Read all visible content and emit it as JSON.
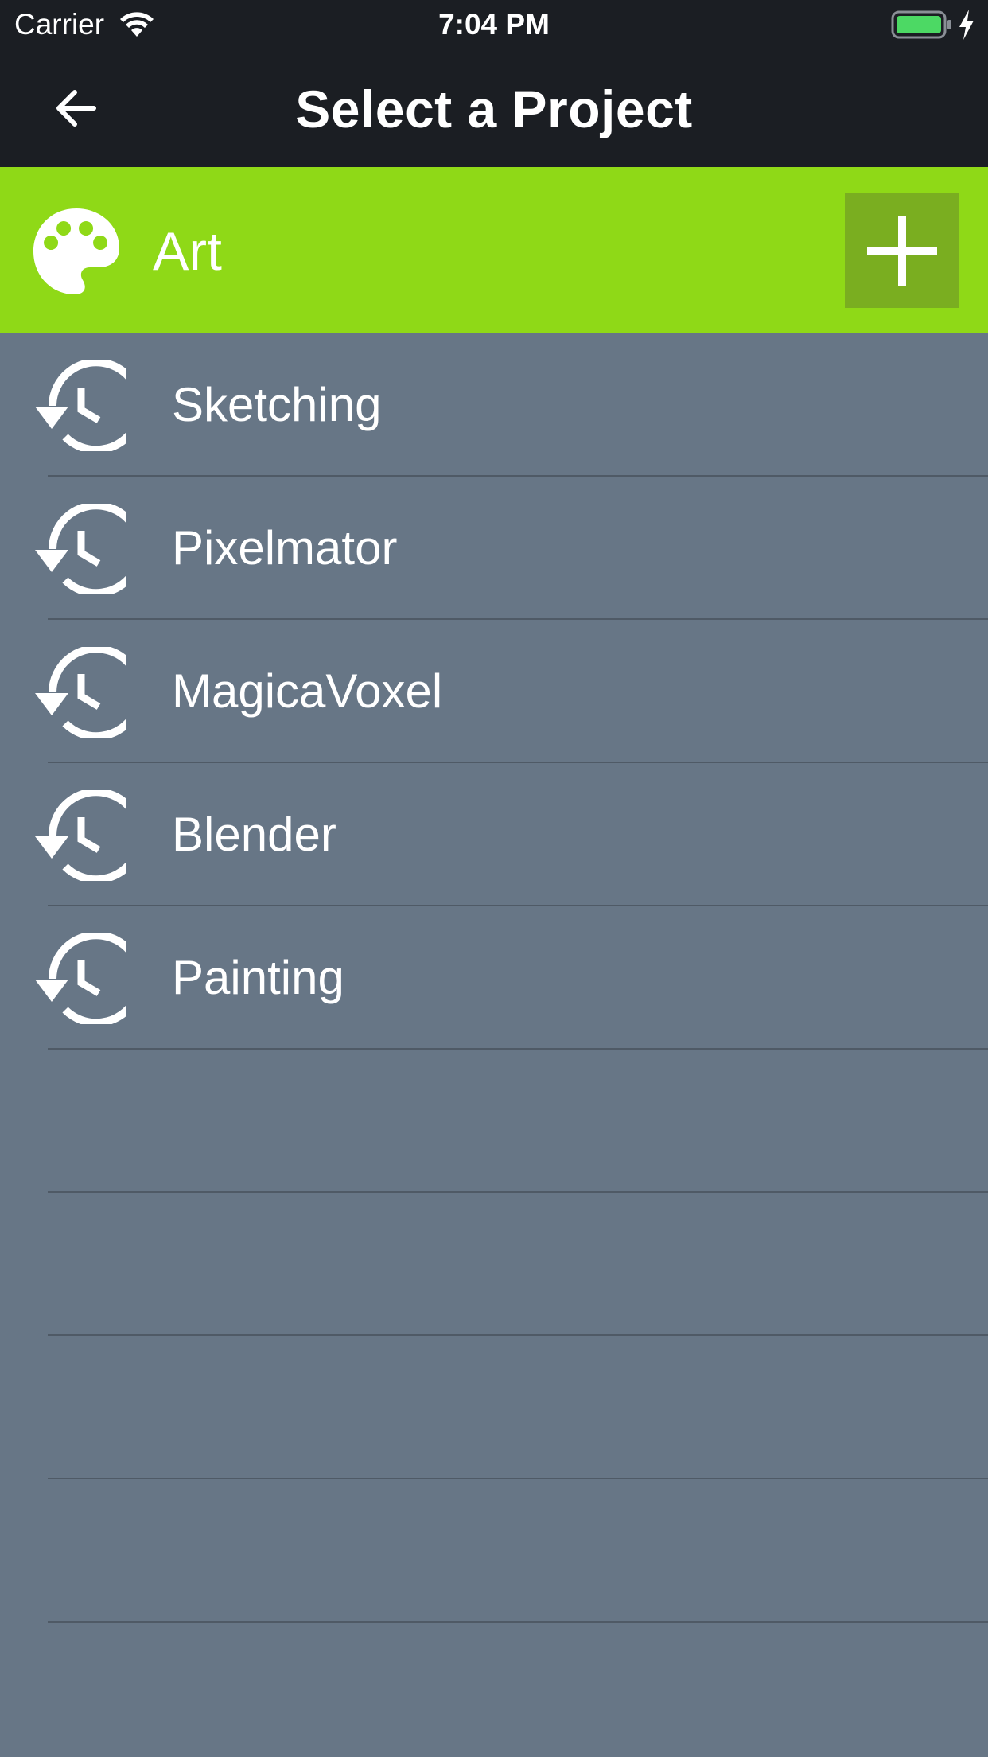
{
  "status_bar": {
    "carrier": "Carrier",
    "time": "7:04 PM",
    "wifi_icon": "wifi-icon",
    "battery_icon": "battery-icon",
    "charging_icon": "charging-bolt-icon",
    "battery_color": "#4cd964"
  },
  "nav": {
    "title": "Select a Project",
    "back_icon": "arrow-left-icon",
    "background": "#1b1e23"
  },
  "category": {
    "name": "Art",
    "icon": "palette-icon",
    "add_icon": "plus-icon",
    "color": "#8fd917",
    "add_button_color": "#7aae20"
  },
  "projects": [
    {
      "name": "Sketching",
      "icon": "history-icon"
    },
    {
      "name": "Pixelmator",
      "icon": "history-icon"
    },
    {
      "name": "MagicaVoxel",
      "icon": "history-icon"
    },
    {
      "name": "Blender",
      "icon": "history-icon"
    },
    {
      "name": "Painting",
      "icon": "history-icon"
    }
  ],
  "list_background": "#677686"
}
